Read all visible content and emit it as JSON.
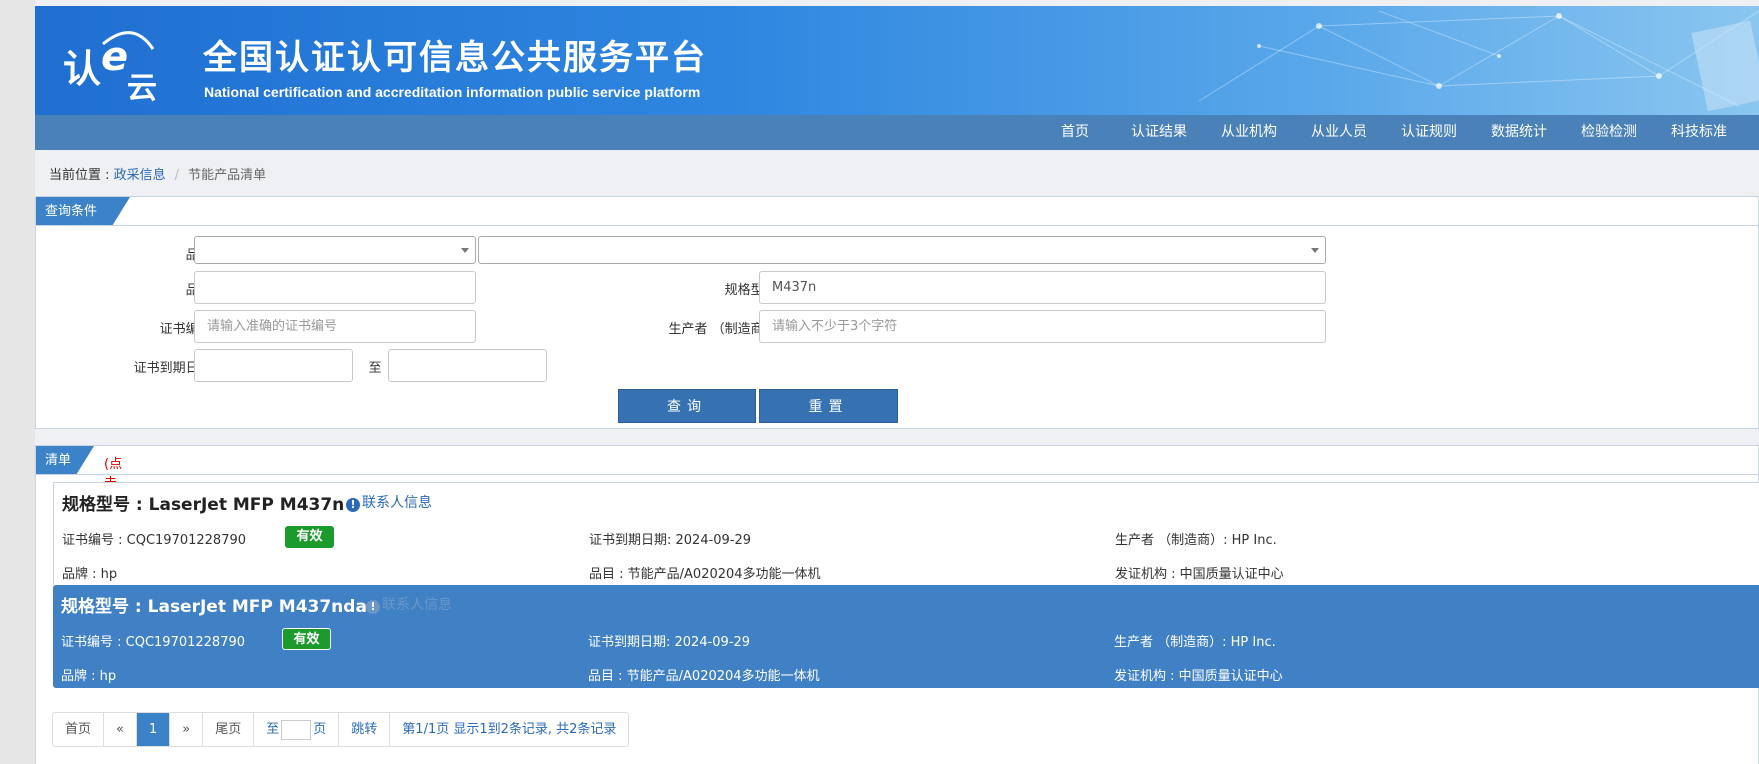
{
  "header": {
    "logo_text": "认e云",
    "title": "全国认证认可信息公共服务平台",
    "subtitle": "National certification and accreditation information public service platform"
  },
  "nav": [
    "首页",
    "认证结果",
    "从业机构",
    "从业人员",
    "认证规则",
    "数据统计",
    "检验检测",
    "科技标准"
  ],
  "breadcrumb": {
    "prefix": "当前位置 : ",
    "link": "政采信息",
    "separator": "/",
    "current": "节能产品清单"
  },
  "query": {
    "panel_title": "查询条件",
    "category_label": "品目:",
    "category_value_1": "",
    "category_value_2": "",
    "brand_label": "品牌:",
    "brand_value": "",
    "model_label": "规格型号:",
    "model_value": "M437n",
    "cert_no_label": "证书编号:",
    "cert_no_placeholder": "请输入准确的证书编号",
    "producer_label": "生产者 （制造商）:",
    "producer_placeholder": "请输入不少于3个字符",
    "expiry_label": "证书到期日期:",
    "expiry_from": "",
    "expiry_to_label": "至",
    "expiry_to": "",
    "search_button": "查询",
    "reset_button": "重置"
  },
  "list": {
    "panel_title": "清单",
    "note": "(点击规格型号, 查看详细信息)",
    "contact_label": "联系人信息",
    "items": [
      {
        "model": "规格型号 : LaserJet MFP M437n",
        "cert_no": "证书编号 : CQC19701228790",
        "status": "有效",
        "expiry": "证书到期日期: 2024-09-29",
        "producer": "生产者 （制造商）: HP Inc.",
        "brand": "品牌 : hp",
        "category": "品目 : 节能产品/A020204多功能一体机",
        "issuer": "发证机构 : 中国质量认证中心"
      },
      {
        "model": "规格型号 : LaserJet MFP M437nda",
        "cert_no": "证书编号 : CQC19701228790",
        "status": "有效",
        "expiry": "证书到期日期: 2024-09-29",
        "producer": "生产者 （制造商）: HP Inc.",
        "brand": "品牌 : hp",
        "category": "品目 : 节能产品/A020204多功能一体机",
        "issuer": "发证机构 : 中国质量认证中心"
      }
    ]
  },
  "pagination": {
    "first": "首页",
    "prev": "«",
    "current_page": "1",
    "next": "»",
    "last": "尾页",
    "goto_prefix": "至",
    "goto_suffix": "页",
    "jump": "跳转",
    "summary": "第1/1页  显示1到2条记录, 共2条记录"
  },
  "colors": {
    "nav_bg": "#4a81b8",
    "accent": "#3b82c8",
    "active_row": "#4080c4",
    "valid_badge": "#1c9a2c",
    "note_red": "#e00000"
  }
}
